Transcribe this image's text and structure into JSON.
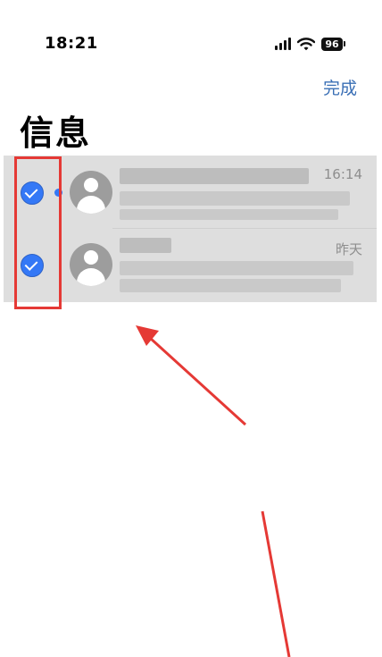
{
  "status_bar": {
    "time": "18:21",
    "battery_level": "96"
  },
  "nav": {
    "done_label": "完成"
  },
  "page": {
    "title": "信息"
  },
  "conversations": [
    {
      "checked": true,
      "unread": true,
      "timestamp": "16:14",
      "name": "",
      "preview": ""
    },
    {
      "checked": true,
      "unread": false,
      "timestamp": "昨天",
      "name": "",
      "preview": ""
    }
  ],
  "colors": {
    "accent": "#3478f6",
    "done_link": "#3a6fb5",
    "annotation": "#e53935",
    "list_background": "#dedede"
  },
  "icons": [
    "signal-icon",
    "wifi-icon",
    "battery-icon",
    "checkmark-icon",
    "avatar-placeholder-icon"
  ]
}
